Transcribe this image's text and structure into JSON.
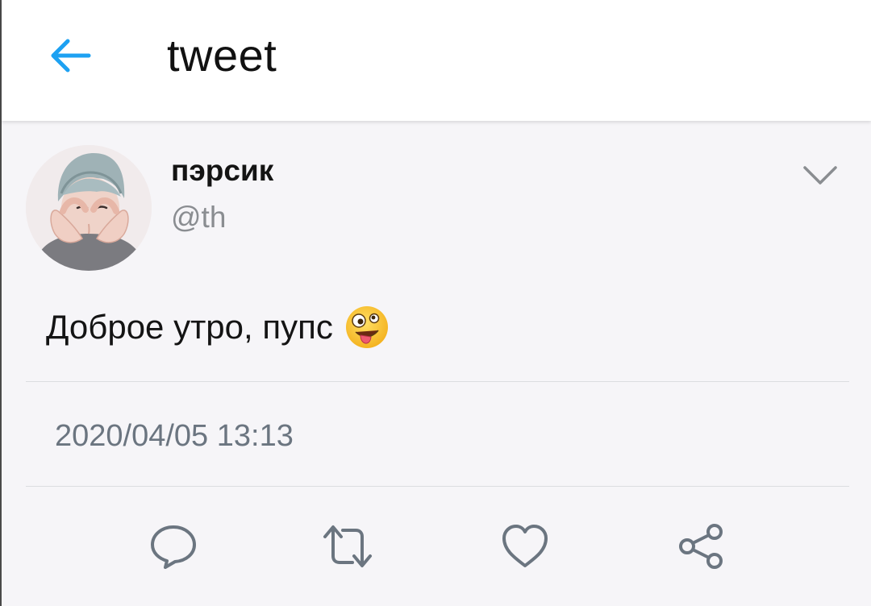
{
  "header": {
    "title": "tweet",
    "back_icon": "arrow-left-icon",
    "accent_color": "#1da1f2"
  },
  "tweet": {
    "display_name": "пэрсик",
    "handle": "@th",
    "text": "Доброе утро, пупс",
    "emoji": "zany-face-emoji",
    "timestamp": "2020/04/05 13:13",
    "more_icon": "chevron-down-icon"
  },
  "actions": [
    {
      "name": "reply",
      "icon": "speech-bubble-icon"
    },
    {
      "name": "retweet",
      "icon": "retweet-icon"
    },
    {
      "name": "like",
      "icon": "heart-icon"
    },
    {
      "name": "share",
      "icon": "share-icon"
    }
  ],
  "colors": {
    "background": "#f6f5f8",
    "header_bg": "#ffffff",
    "icon_gray": "#6b7580",
    "muted_text": "#8a8d91",
    "divider": "#dcdde0"
  }
}
